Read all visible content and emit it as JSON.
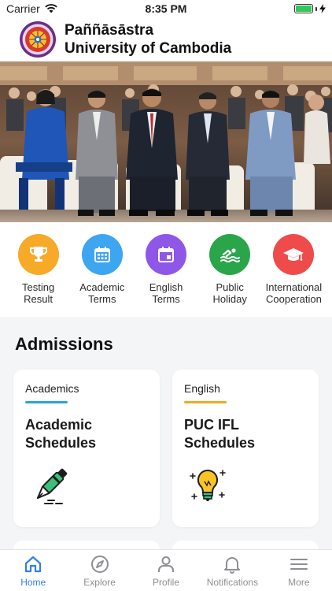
{
  "status": {
    "carrier": "Carrier",
    "time": "8:35 PM"
  },
  "header": {
    "title_line1": "Paññāsāstra",
    "title_line2": "University of Cambodia"
  },
  "quick_links": [
    {
      "line1": "Testing",
      "line2": "Result",
      "icon": "trophy-icon",
      "color": "#f7a928"
    },
    {
      "line1": "Academic",
      "line2": "Terms",
      "icon": "calendar-grid-icon",
      "color": "#3ea5f0"
    },
    {
      "line1": "English",
      "line2": "Terms",
      "icon": "calendar-icon",
      "color": "#8f57e8"
    },
    {
      "line1": "Public",
      "line2": "Holiday",
      "icon": "swimming-icon",
      "color": "#2aa54a"
    },
    {
      "line1": "International",
      "line2": "Cooperation",
      "icon": "graduation-cap-icon",
      "color": "#ef4b4b"
    }
  ],
  "admissions": {
    "title": "Admissions",
    "cards": [
      {
        "category": "Academics",
        "title_line1": "Academic",
        "title_line2": "Schedules",
        "accent": "#29a3e6",
        "icon": "pen-icon"
      },
      {
        "category": "English",
        "title_line1": "PUC IFL",
        "title_line2": "Schedules",
        "accent": "#f5a623",
        "icon": "lightbulb-icon"
      }
    ]
  },
  "tabs": [
    {
      "label": "Home",
      "icon": "home-icon",
      "active": true
    },
    {
      "label": "Explore",
      "icon": "compass-icon",
      "active": false
    },
    {
      "label": "Profile",
      "icon": "user-icon",
      "active": false
    },
    {
      "label": "Notifications",
      "icon": "bell-icon",
      "active": false
    },
    {
      "label": "More",
      "icon": "menu-icon",
      "active": false
    }
  ],
  "colors": {
    "active_tab": "#2f80ed",
    "inactive_tab": "#8e8e93",
    "battery": "#34c759"
  }
}
